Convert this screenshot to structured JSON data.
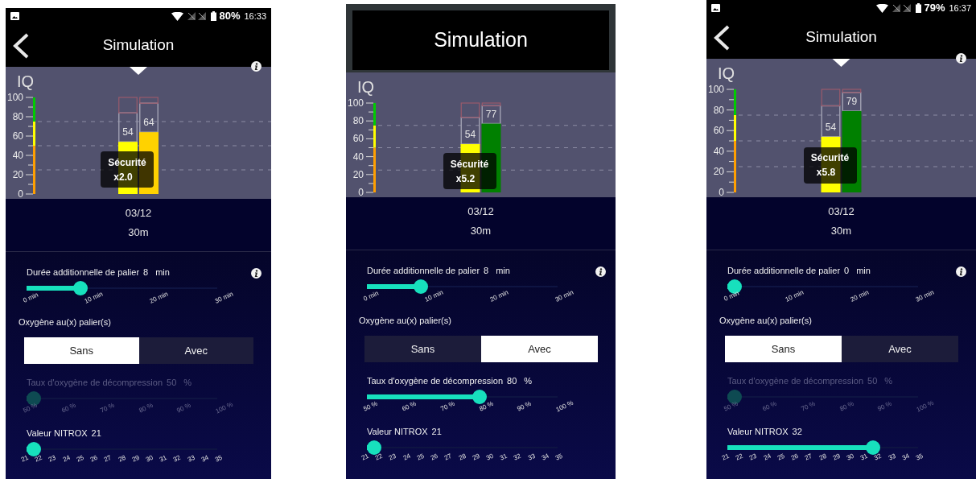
{
  "phones": [
    {
      "status_bar": {
        "battery": "80%",
        "time": "16:33"
      },
      "header": {
        "kind": "bar",
        "title": "Simulation"
      },
      "chart": {
        "tooltip": {
          "label": "Sécurité",
          "value": "x2.0"
        },
        "depth": "30m",
        "chart_data": {
          "type": "bar",
          "ylabel": "IQ",
          "categories": [
            "03/12"
          ],
          "ylim": [
            0,
            100
          ],
          "yticks": [
            0,
            20,
            40,
            60,
            80,
            100
          ],
          "data_labels": true,
          "series": [
            {
              "color": "#ffff00",
              "values": [
                54
              ]
            },
            {
              "color": "#ffd200",
              "values": [
                64
              ]
            }
          ]
        }
      },
      "controls": [
        {
          "kind": "slider",
          "label": "Durée additionnelle de palier",
          "value": "8",
          "unit": "min",
          "level": 0.267,
          "disabled": false,
          "ticks": [
            "0 min",
            "10 min",
            "20 min",
            "30 min"
          ]
        },
        {
          "kind": "segmented",
          "label": "Oxygène au(x) palier(s)",
          "options": [
            {
              "label": "Sans",
              "selected": true
            },
            {
              "label": "Avec",
              "selected": false
            }
          ]
        },
        {
          "kind": "slider",
          "label": "Taux d'oxygène de décompression",
          "value": "50",
          "unit": "%",
          "level": 0,
          "disabled": true,
          "ticks": [
            "50 %",
            "60 %",
            "70 %",
            "80 %",
            "90 %",
            "100 %"
          ]
        },
        {
          "kind": "slider",
          "label": "Valeur NITROX",
          "value": "21",
          "level": 0,
          "disabled": false,
          "ticks": [
            "21",
            "22",
            "23",
            "24",
            "25",
            "26",
            "27",
            "28",
            "29",
            "30",
            "31",
            "32",
            "33",
            "34",
            "35"
          ]
        }
      ]
    },
    {
      "header": {
        "kind": "boxed",
        "title": "Simulation"
      },
      "chart": {
        "tooltip": {
          "label": "Sécurité",
          "value": "x5.2"
        },
        "depth": "30m",
        "chart_data": {
          "type": "bar",
          "ylabel": "IQ",
          "categories": [
            "03/12"
          ],
          "ylim": [
            0,
            100
          ],
          "yticks": [
            0,
            20,
            40,
            60,
            80,
            100
          ],
          "data_labels": true,
          "series": [
            {
              "color": "#ffff00",
              "values": [
                54
              ]
            },
            {
              "color": "#008000",
              "values": [
                77
              ]
            }
          ]
        }
      },
      "controls": [
        {
          "kind": "slider",
          "label": "Durée additionnelle de palier",
          "value": "8",
          "unit": "min",
          "level": 0.267,
          "disabled": false,
          "ticks": [
            "0 min",
            "10 min",
            "20 min",
            "30 min"
          ]
        },
        {
          "kind": "segmented",
          "label": "Oxygène au(x) palier(s)",
          "options": [
            {
              "label": "Sans",
              "selected": false
            },
            {
              "label": "Avec",
              "selected": true
            }
          ]
        },
        {
          "kind": "slider",
          "label": "Taux d'oxygène de décompression",
          "value": "80",
          "unit": "%",
          "level": 0.6,
          "disabled": false,
          "ticks": [
            "50 %",
            "60 %",
            "70 %",
            "80 %",
            "90 %",
            "100 %"
          ]
        },
        {
          "kind": "slider",
          "label": "Valeur NITROX",
          "value": "21",
          "level": 0,
          "disabled": false,
          "ticks": [
            "21",
            "22",
            "23",
            "24",
            "25",
            "26",
            "27",
            "28",
            "29",
            "30",
            "31",
            "32",
            "33",
            "34",
            "35"
          ]
        }
      ]
    },
    {
      "status_bar": {
        "battery": "79%",
        "time": "16:37"
      },
      "header": {
        "kind": "bar",
        "title": "Simulation"
      },
      "chart": {
        "tooltip": {
          "label": "Sécurité",
          "value": "x5.8"
        },
        "depth": "30m",
        "chart_data": {
          "type": "bar",
          "ylabel": "IQ",
          "categories": [
            "03/12"
          ],
          "ylim": [
            0,
            100
          ],
          "yticks": [
            0,
            20,
            40,
            60,
            80,
            100
          ],
          "data_labels": true,
          "series": [
            {
              "color": "#ffff00",
              "values": [
                54
              ]
            },
            {
              "color": "#008000",
              "values": [
                79
              ]
            }
          ]
        }
      },
      "controls": [
        {
          "kind": "slider",
          "label": "Durée additionnelle de palier",
          "value": "0",
          "unit": "min",
          "level": 0,
          "disabled": false,
          "ticks": [
            "0 min",
            "10 min",
            "20 min",
            "30 min"
          ]
        },
        {
          "kind": "segmented",
          "label": "Oxygène au(x) palier(s)",
          "options": [
            {
              "label": "Sans",
              "selected": true
            },
            {
              "label": "Avec",
              "selected": false
            }
          ]
        },
        {
          "kind": "slider",
          "label": "Taux d'oxygène de décompression",
          "value": "50",
          "unit": "%",
          "level": 0,
          "disabled": true,
          "ticks": [
            "50 %",
            "60 %",
            "70 %",
            "80 %",
            "90 %",
            "100 %"
          ]
        },
        {
          "kind": "slider",
          "label": "Valeur NITROX",
          "value": "32",
          "level": 0.786,
          "disabled": false,
          "ticks": [
            "21",
            "22",
            "23",
            "24",
            "25",
            "26",
            "27",
            "28",
            "29",
            "30",
            "31",
            "32",
            "33",
            "34",
            "35"
          ]
        }
      ]
    }
  ]
}
